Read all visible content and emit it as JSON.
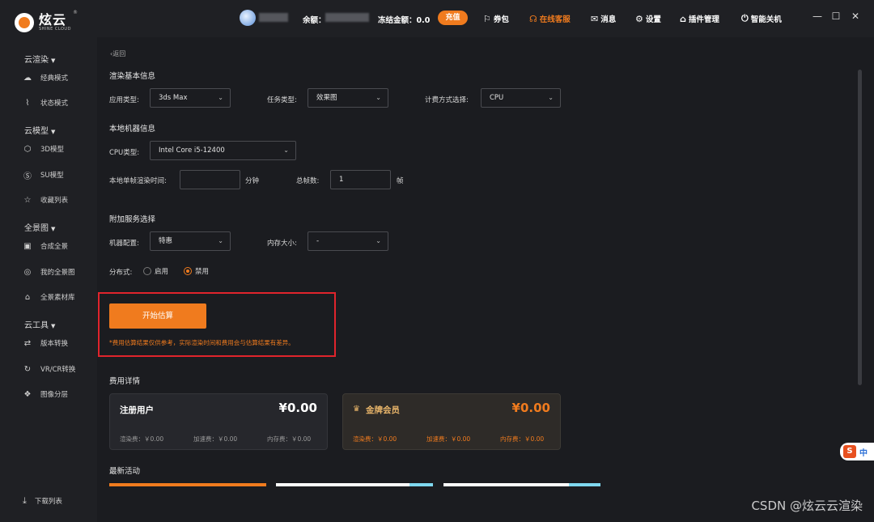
{
  "app": {
    "logo_cn": "炫云",
    "logo_en": "SHINE CLOUD",
    "logo_reg": "®"
  },
  "topbar": {
    "balance_label": "余额：",
    "frozen_label": "冻结金额：0.0",
    "recharge": "充值",
    "links": [
      {
        "icon": "gift-icon",
        "glyph": "⚐",
        "label": "券包"
      },
      {
        "icon": "headset-icon",
        "glyph": "☊",
        "label": "在线客服"
      },
      {
        "icon": "mail-icon",
        "glyph": "✉",
        "label": "消息"
      },
      {
        "icon": "gear-icon",
        "glyph": "⚙",
        "label": "设置"
      },
      {
        "icon": "plugin-icon",
        "glyph": "⌂",
        "label": "插件管理"
      },
      {
        "icon": "power-icon",
        "glyph": "⏻",
        "label": "智能关机"
      }
    ],
    "window": [
      "—",
      "☐",
      "✕"
    ]
  },
  "sidebar": {
    "groups": [
      {
        "label": "云渲染",
        "items": [
          {
            "icon": "cloud-icon",
            "glyph": "☁",
            "label": "经典模式"
          },
          {
            "icon": "pulse-icon",
            "glyph": "⌇",
            "label": "状态模式"
          }
        ]
      },
      {
        "label": "云模型",
        "items": [
          {
            "icon": "cube-icon",
            "glyph": "⬡",
            "label": "3D模型"
          },
          {
            "icon": "su-icon",
            "glyph": "Ⓢ",
            "label": "SU模型"
          },
          {
            "icon": "star-icon",
            "glyph": "☆",
            "label": "收藏列表"
          }
        ]
      },
      {
        "label": "全景图",
        "items": [
          {
            "icon": "image-icon",
            "glyph": "▣",
            "label": "合成全景"
          },
          {
            "icon": "planet-icon",
            "glyph": "◎",
            "label": "我的全景图"
          },
          {
            "icon": "library-icon",
            "glyph": "⌂",
            "label": "全景素材库"
          }
        ]
      },
      {
        "label": "云工具",
        "items": [
          {
            "icon": "convert-icon",
            "glyph": "⇄",
            "label": "版本转换"
          },
          {
            "icon": "vr-icon",
            "glyph": "↻",
            "label": "VR/CR转换"
          },
          {
            "icon": "layers-icon",
            "glyph": "❖",
            "label": "图像分层"
          }
        ]
      }
    ],
    "download": {
      "icon": "download-icon",
      "glyph": "⤓",
      "label": "下载列表"
    }
  },
  "main": {
    "back": "‹返回",
    "basic_title": "渲染基本信息",
    "app_type_label": "应用类型:",
    "app_type_value": "3ds Max",
    "task_type_label": "任务类型:",
    "task_type_value": "效果图",
    "billing_label": "计费方式选择:",
    "billing_value": "CPU",
    "local_title": "本地机器信息",
    "cpu_label": "CPU类型:",
    "cpu_value": "Intel Core i5-12400",
    "frame_time_label": "本地单帧渲染时间:",
    "frame_time_value": "",
    "frame_time_unit": "分钟",
    "total_frames_label": "总帧数:",
    "total_frames_value": "1",
    "total_frames_unit": "帧",
    "addon_title": "附加服务选择",
    "machine_label": "机器配置:",
    "machine_value": "特惠",
    "memory_label": "内存大小:",
    "memory_value": "-",
    "distributed_label": "分布式:",
    "radio_enable": "启用",
    "radio_disable": "禁用",
    "estimate_button": "开始估算",
    "note": "*费用估算结果仅供参考，实际渲染时间和费用会与估算结果有差异。",
    "cost_title": "费用详情",
    "activity_title": "最新活动"
  },
  "cards": [
    {
      "title": "注册用户",
      "price": "¥0.00",
      "render": "渲染费：￥0.00",
      "speedup": "加速费：￥0.00",
      "memory": "内存费：￥0.00"
    },
    {
      "title": "金牌会员",
      "price": "¥0.00",
      "render": "渲染费：￥0.00",
      "speedup": "加速费：￥0.00",
      "memory": "内存费：￥0.00"
    }
  ],
  "ime": {
    "brand": "S",
    "mode": "中"
  },
  "watermark": "CSDN @炫云云渲染",
  "colors": {
    "accent": "#f07b1e",
    "highlight": "#e0242c",
    "gold": "#e8b56a"
  }
}
